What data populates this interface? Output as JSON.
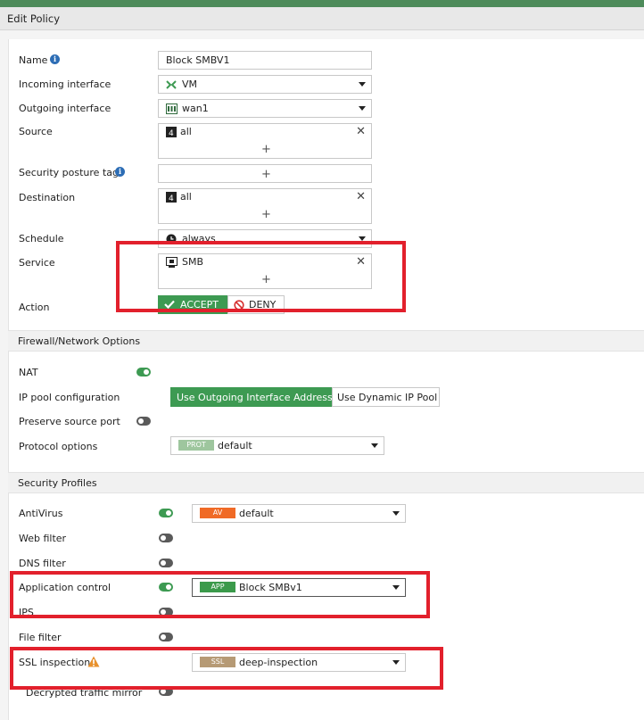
{
  "header": {
    "title": "Edit Policy"
  },
  "policy": {
    "name_label": "Name",
    "name_value": "Block SMBV1",
    "incoming_label": "Incoming interface",
    "incoming_value": "VM",
    "outgoing_label": "Outgoing interface",
    "outgoing_value": "wan1",
    "source_label": "Source",
    "source_value": "all",
    "posture_label": "Security posture tag",
    "destination_label": "Destination",
    "destination_value": "all",
    "schedule_label": "Schedule",
    "schedule_value": "always",
    "service_label": "Service",
    "service_value": "SMB",
    "action_label": "Action",
    "accept_label": "ACCEPT",
    "deny_label": "DENY",
    "plus": "+",
    "remove": "✕"
  },
  "firewall": {
    "section_title": "Firewall/Network Options",
    "nat_label": "NAT",
    "nat_enabled": true,
    "ippool_label": "IP pool configuration",
    "ippool_options": [
      "Use Outgoing Interface Address",
      "Use Dynamic IP Pool"
    ],
    "preserve_label": "Preserve source port",
    "preserve_enabled": false,
    "protocol_label": "Protocol options",
    "protocol_badge": "PROT",
    "protocol_value": "default"
  },
  "profiles": {
    "section_title": "Security Profiles",
    "antivirus_label": "AntiVirus",
    "antivirus_enabled": true,
    "antivirus_badge": "AV",
    "antivirus_value": "default",
    "webfilter_label": "Web filter",
    "dnsfilter_label": "DNS filter",
    "appcontrol_label": "Application control",
    "appcontrol_enabled": true,
    "appcontrol_badge": "APP",
    "appcontrol_value": "Block SMBv1",
    "ips_label": "IPS",
    "filefilter_label": "File filter",
    "ssl_label": "SSL inspection",
    "ssl_badge": "SSL",
    "ssl_value": "deep-inspection",
    "decrypted_label": "Decrypted traffic mirror"
  },
  "colors": {
    "accent_green": "#3d9a52",
    "highlight_red": "#e2202c",
    "av_badge": "#f06a26",
    "app_badge": "#3b9a4b",
    "ssl_badge": "#b69a75",
    "prot_badge": "#9ec69e"
  }
}
